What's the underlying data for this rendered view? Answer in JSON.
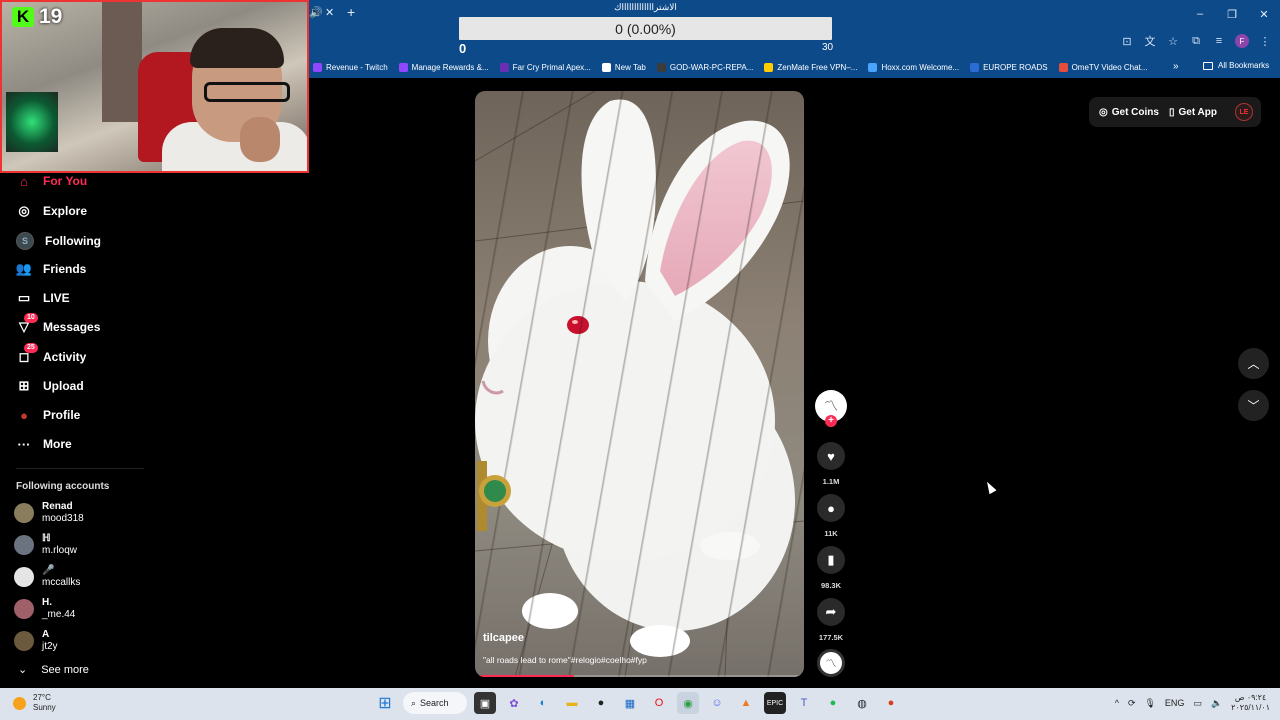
{
  "stream_overlay": {
    "kick_count": "19",
    "goal": {
      "title": "الاشتراااااااااااااك",
      "progress_text": "0 (0.00%)",
      "progress_fraction": 0,
      "min": "0",
      "max": "30"
    }
  },
  "browser": {
    "tab_close": "✕",
    "new_tab": "+",
    "window_controls": [
      "–",
      "❐",
      "✕"
    ],
    "bookmarks": [
      {
        "label": "Revenue - Twitch",
        "color": "#9146ff"
      },
      {
        "label": "Manage Rewards &...",
        "color": "#9146ff"
      },
      {
        "label": "Far Cry Primal Apex...",
        "color": "#6b2fb5"
      },
      {
        "label": "New Tab",
        "color": "#ffffff"
      },
      {
        "label": "GOD-WAR-PC-REPA...",
        "color": "#3b3b3b"
      },
      {
        "label": "ZenMate Free VPN–...",
        "color": "#ffcc00"
      },
      {
        "label": "Hoxx.com Welcome...",
        "color": "#4aa3ff"
      },
      {
        "label": "EUROPE ROADS",
        "color": "#2a6bd6"
      },
      {
        "label": "OmeTV Video Chat...",
        "color": "#e74c3c"
      }
    ],
    "bookmarks_more": "»",
    "all_bookmarks": "All Bookmarks",
    "profile_letter": "F"
  },
  "sidebar": {
    "nav": [
      {
        "label": "For You",
        "icon": "home-icon",
        "glyph": "⌂",
        "active": true
      },
      {
        "label": "Explore",
        "icon": "compass-icon",
        "glyph": "◎"
      },
      {
        "label": "Following",
        "icon": "following-avatar-icon",
        "glyph": "S"
      },
      {
        "label": "Friends",
        "icon": "friends-icon",
        "glyph": "👥"
      },
      {
        "label": "LIVE",
        "icon": "live-icon",
        "glyph": "▭"
      },
      {
        "label": "Messages",
        "icon": "messages-icon",
        "glyph": "▽",
        "badge": "10"
      },
      {
        "label": "Activity",
        "icon": "activity-icon",
        "glyph": "◻",
        "badge": "25"
      },
      {
        "label": "Upload",
        "icon": "upload-icon",
        "glyph": "⊞"
      },
      {
        "label": "Profile",
        "icon": "profile-icon",
        "glyph": "●"
      },
      {
        "label": "More",
        "icon": "more-icon",
        "glyph": "···"
      }
    ],
    "following_title": "Following accounts",
    "accounts": [
      {
        "name": "Renad",
        "id": "mood318",
        "color": "#8a7d5e"
      },
      {
        "name": "ℍ",
        "id": "m.rloqw",
        "color": "#6b7280"
      },
      {
        "name": "🎤",
        "id": "mccallks",
        "color": "#e5e5e5"
      },
      {
        "name": "H.",
        "id": "_me.44",
        "color": "#a0606a"
      },
      {
        "name": "A",
        "id": "jt2y",
        "color": "#6b5a3e"
      }
    ],
    "see_more": "See more"
  },
  "video": {
    "author": "tilcapee",
    "caption": "\"all roads lead to rome\"#relogio#coelho#fyp",
    "progress_fraction": 0.3
  },
  "actions": {
    "like_count": "1.1M",
    "comment_count": "11K",
    "save_count": "98.3K",
    "share_count": "177.5K"
  },
  "topbar": {
    "get_coins": "Get Coins",
    "get_app": "Get App"
  },
  "taskbar": {
    "temperature": "27°C",
    "condition": "Sunny",
    "search": "Search",
    "language": "ENG",
    "time": "٠٩:٢٤ ص",
    "date": "٢٠٢٥/١١/٠١"
  }
}
